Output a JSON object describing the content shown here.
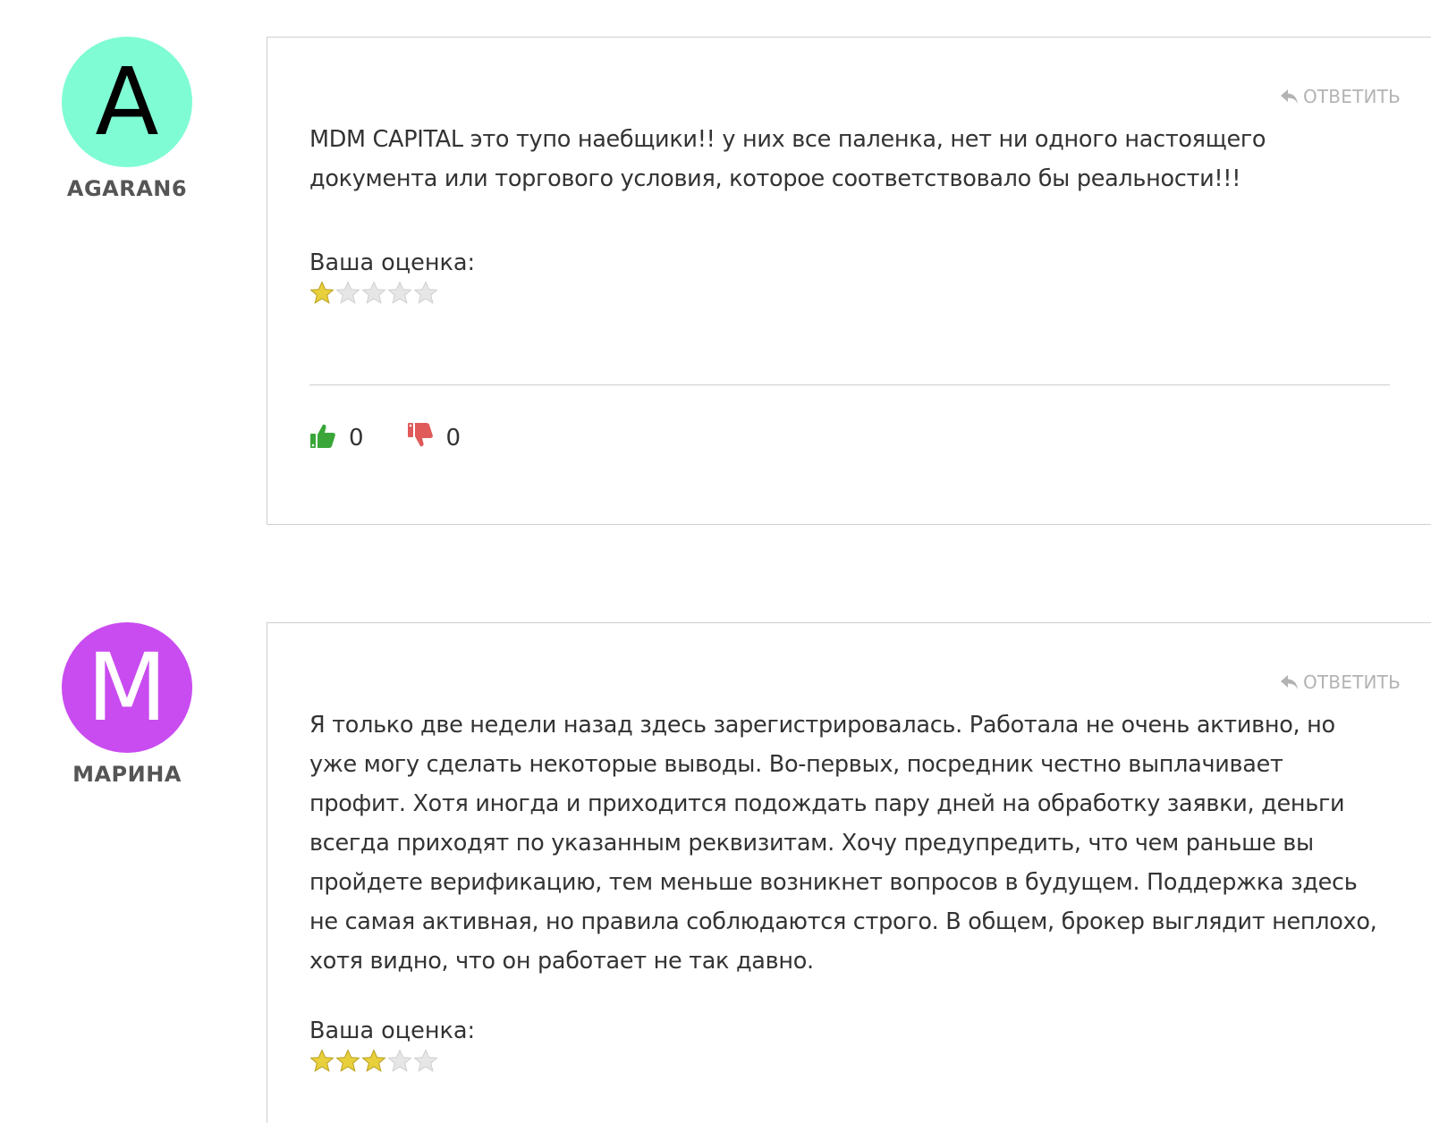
{
  "comments": [
    {
      "author": {
        "initial": "A",
        "name": "AGARAN6",
        "avatar_color": "#7ffcd4",
        "initial_color": "#000000"
      },
      "reply_label": "ОТВЕТИТЬ",
      "text": "MDM CAPITAL это тупо наебщики!! у них все паленка, нет ни одного настоящего документа или торгового условия, которое соответствовало бы реальности!!!",
      "rating_label": "Ваша оценка:",
      "rating": 1,
      "rating_max": 5,
      "likes": "0",
      "dislikes": "0"
    },
    {
      "author": {
        "initial": "M",
        "name": "МАРИНА",
        "avatar_color": "#c94cf0",
        "initial_color": "#ffffff"
      },
      "reply_label": "ОТВЕТИТЬ",
      "text": "Я только две недели назад здесь зарегистрировалась. Работала не очень активно, но уже могу сделать некоторые выводы. Во-первых, посредник честно выплачивает профит. Хотя иногда и приходится подождать пару дней на обработку заявки, деньги всегда приходят по указанным реквизитам. Хочу предупредить, что чем раньше вы пройдете верификацию, тем меньше возникнет вопросов в будущем. Поддержка здесь не самая активная, но правила соблюдаются строго. В общем, брокер выглядит неплохо, хотя видно, что он работает не так давно.",
      "rating_label": "Ваша оценка:",
      "rating": 3,
      "rating_max": 5
    }
  ],
  "colors": {
    "star_filled": "#e8cf3c",
    "star_empty": "#e6e6e6",
    "like": "#3aa63a",
    "dislike": "#e05a5a",
    "reply": "#b3b3b3"
  }
}
